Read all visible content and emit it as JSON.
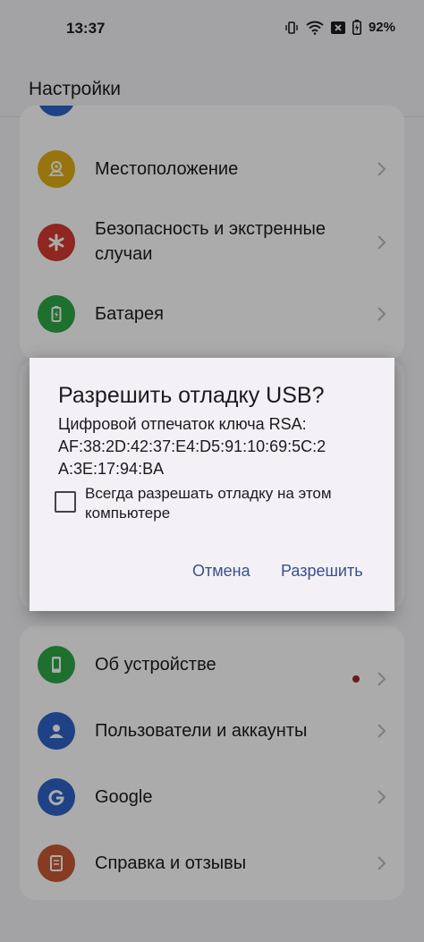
{
  "status_bar": {
    "time": "13:37",
    "battery": "92%",
    "icons": [
      "vibrate-icon",
      "wifi-icon",
      "notification-x-icon",
      "battery-icon"
    ]
  },
  "app_bar": {
    "title": "Настройки"
  },
  "settings": {
    "items_top": [
      {
        "label": "Местоположение",
        "icon": "location-icon",
        "color": "#e2ae14"
      },
      {
        "label": "Безопасность и экстренные случаи",
        "icon": "emergency-icon",
        "color": "#d63a2f"
      },
      {
        "label": "Батарея",
        "icon": "battery-icon",
        "color": "#2ea845"
      }
    ],
    "items_bottom": [
      {
        "label": "Об устройстве",
        "icon": "phone-icon",
        "color": "#2ea845",
        "badge": true,
        "badge_color": "#9e2b25"
      },
      {
        "label": "Пользователи и аккаунты",
        "icon": "account-icon",
        "color": "#2e63c7"
      },
      {
        "label": "Google",
        "icon": "google-icon",
        "color": "#2e63c7"
      },
      {
        "label": "Справка и отзывы",
        "icon": "help-icon",
        "color": "#c85a34"
      }
    ],
    "partial_top_icon_color": "#2e63c7"
  },
  "dialog": {
    "title": "Разрешить отладку USB?",
    "body_line1": "Цифровой отпечаток ключа RSA:",
    "body_line2": "AF:38:2D:42:37:E4:D5:91:10:69:5C:2",
    "body_line3": "A:3E:17:94:BA",
    "checkbox_label": "Всегда разрешать отладку на этом компьютере",
    "checkbox_checked": false,
    "cancel_label": "Отмена",
    "allow_label": "Разрешить",
    "button_color": "#3a4f8c"
  }
}
